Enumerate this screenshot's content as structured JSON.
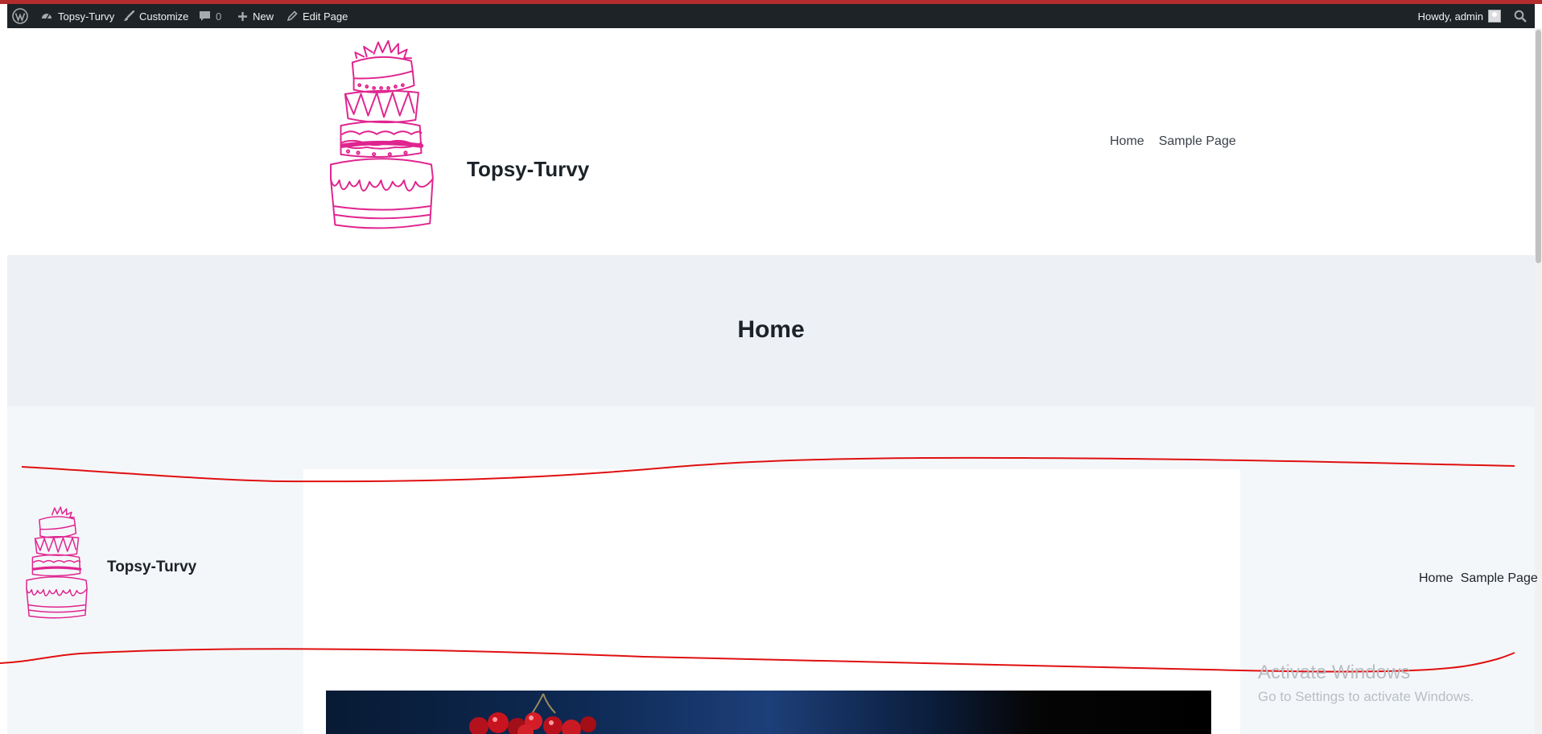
{
  "admin_bar": {
    "site_name": "Topsy-Turvy",
    "customize": "Customize",
    "comments_count": "0",
    "new_label": "New",
    "edit_page": "Edit Page",
    "greeting": "Howdy, admin"
  },
  "header": {
    "site_title": "Topsy-Turvy",
    "nav": [
      "Home",
      "Sample Page"
    ]
  },
  "hero": {
    "title": "Home"
  },
  "content": {
    "header_block": {
      "site_title": "Topsy-Turvy",
      "nav": [
        "Home",
        "Sample Page"
      ]
    }
  },
  "os_watermark": {
    "line1": "Activate Windows",
    "line2": "Go to Settings to activate Windows."
  },
  "colors": {
    "admin_bar_bg": "#1d2327",
    "logo_magenta": "#e0248f",
    "hero_bg": "#edf1f5",
    "annotation_red": "#e01010"
  },
  "icons": [
    "wordpress-icon",
    "dashboard-icon",
    "brush-icon",
    "comment-icon",
    "plus-icon",
    "pencil-icon",
    "search-icon"
  ]
}
